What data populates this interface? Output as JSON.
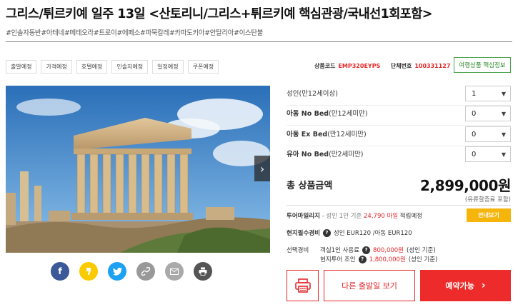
{
  "product": {
    "title": "그리스/튀르키예 일주 13일 <산토리니/그리스+튀르키예 핵심관광/국내선1회포함>",
    "tags": "#인솔자동반#아테네#메테오라#트로이#에페소#파묵칼레#카파도키아#안탈리아#이스탄불"
  },
  "tabs": [
    "출발예정",
    "가격예정",
    "호텔예정",
    "인솔자예정",
    "일정예정",
    "쿠폰예정"
  ],
  "codes": {
    "product_code_label": "상품코드",
    "product_code": "EMP320EYPS",
    "group_no_label": "단체번호",
    "group_no": "100331127",
    "info_button": "여행상품 핵심정보"
  },
  "options": [
    {
      "label_main": "성인",
      "label_sub": "(만12세이상)",
      "value": "1"
    },
    {
      "label_main": "아동 No Bed",
      "label_sub": "(만12세미만)",
      "value": "0"
    },
    {
      "label_main": "아동 Ex Bed",
      "label_sub": "(만12세미만)",
      "value": "0"
    },
    {
      "label_main": "유아 No Bed",
      "label_sub": "(만2세미만)",
      "value": "0"
    }
  ],
  "total": {
    "label": "총 상품금액",
    "value": "2,899,000원",
    "note": "(유류할증료 포함)"
  },
  "mileage": {
    "label": "투어마일리지",
    "prefix": " - 성인 1인 기준 ",
    "amount": "24,790 마일",
    "suffix": " 적립예정",
    "button": "안내보기"
  },
  "local_fee": {
    "label": "현지필수경비",
    "text": "성인 EUR120 /아동 EUR120"
  },
  "selective": {
    "label": "선택경비",
    "line1_label": "객실1인 사용료",
    "line1_amount": "800,000원",
    "line1_suffix": "(성인 기준)",
    "line2_label": "현지투어 조인",
    "line2_amount": "1,800,000원",
    "line2_suffix": "(성인 기준)"
  },
  "actions": {
    "dates_button": "다른 출발일 보기",
    "book_button": "예약가능"
  },
  "colors": {
    "accent_red": "#e4282b",
    "mileage_yellow": "#f6b50a",
    "info_green": "#2b8a2b",
    "facebook": "#3b5998",
    "kakao": "#f9cb00",
    "twitter": "#1da1f2",
    "gray_share": "#999999",
    "print_share": "#555555"
  },
  "share_icons": [
    "facebook-icon",
    "kakaostory-icon",
    "twitter-icon",
    "link-icon",
    "email-icon",
    "print-icon"
  ]
}
